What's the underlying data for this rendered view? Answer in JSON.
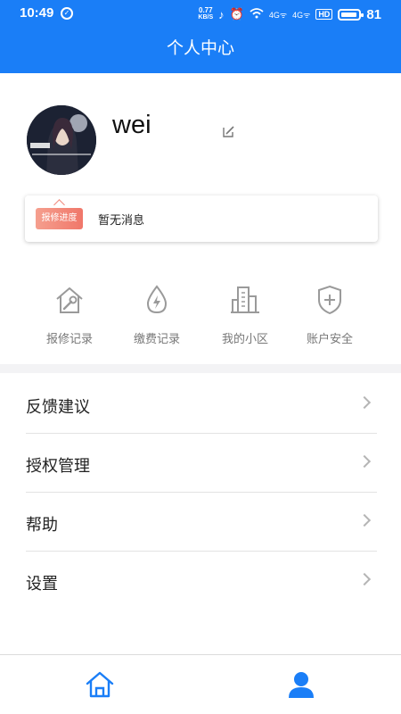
{
  "status_bar": {
    "time": "10:49",
    "net_speed_value": "0.77",
    "net_speed_unit": "KB/S",
    "signal_1": "4G",
    "signal_2": "4G",
    "hd_badge": "HD",
    "battery_level": "81"
  },
  "header": {
    "title": "个人中心"
  },
  "profile": {
    "username": "wei"
  },
  "notice": {
    "tag_label": "报修进度",
    "message": "暂无消息"
  },
  "shortcuts": [
    {
      "label": "报修记录",
      "icon": "house-wrench-icon"
    },
    {
      "label": "缴费记录",
      "icon": "water-drop-bolt-icon"
    },
    {
      "label": "我的小区",
      "icon": "buildings-icon"
    },
    {
      "label": "账户安全",
      "icon": "shield-plus-icon"
    }
  ],
  "menu": [
    {
      "label": "反馈建议"
    },
    {
      "label": "授权管理"
    },
    {
      "label": "帮助"
    },
    {
      "label": "设置"
    }
  ],
  "tabbar": {
    "tabs": [
      {
        "icon": "home-icon",
        "active": false
      },
      {
        "icon": "user-icon",
        "active": true
      }
    ]
  },
  "colors": {
    "primary": "#1a7ef7",
    "tag": "#f0776a",
    "icon_gray": "#9a9a9a"
  }
}
